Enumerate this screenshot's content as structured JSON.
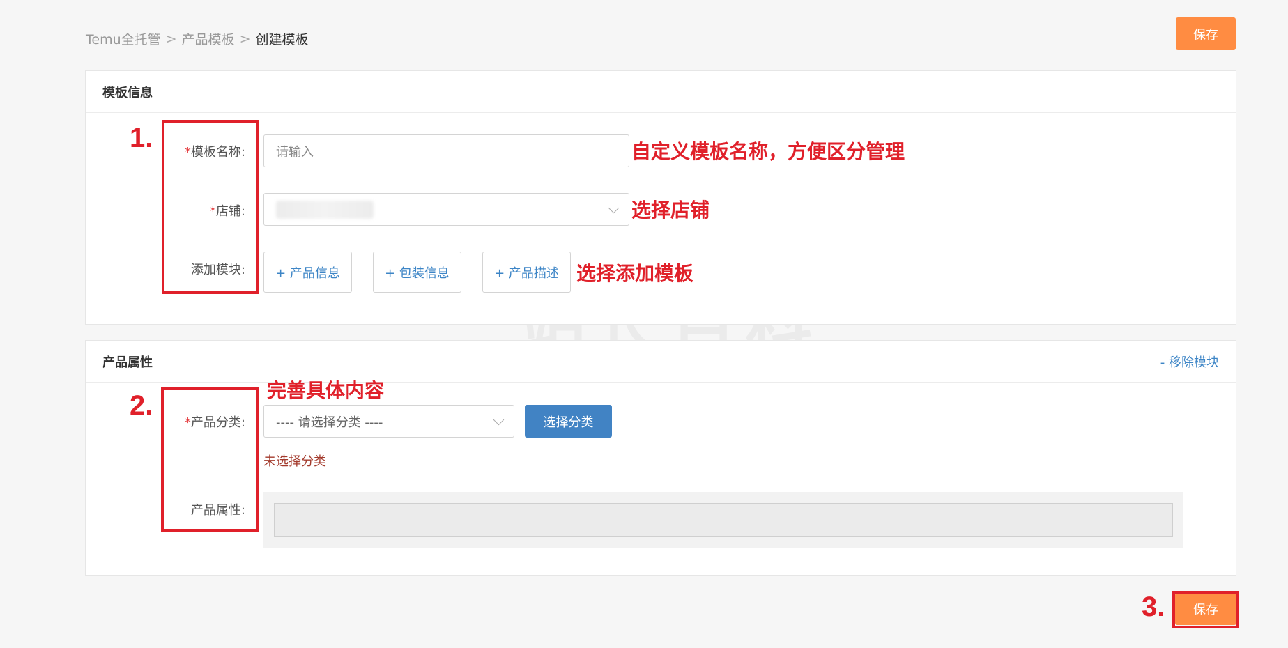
{
  "breadcrumb": {
    "items": [
      "Temu全托管",
      "产品模板",
      "创建模板"
    ]
  },
  "header": {
    "save_label": "保存"
  },
  "template_info": {
    "title": "模板信息",
    "name_label": "模板名称:",
    "name_placeholder": "请输入",
    "shop_label": "店铺:",
    "add_module_label": "添加模块:",
    "modules": [
      "+ 产品信息",
      "+ 包装信息",
      "+ 产品描述"
    ]
  },
  "product_attrs": {
    "title": "产品属性",
    "remove_label": "- 移除模块",
    "category_label": "产品分类:",
    "category_placeholder": "---- 请选择分类 ----",
    "choose_button": "选择分类",
    "error": "未选择分类",
    "attr_label": "产品属性:"
  },
  "annotations": {
    "n1": "1.",
    "n2": "2.",
    "n3": "3.",
    "name_note": "自定义模板名称，方便区分管理",
    "shop_note": "选择店铺",
    "module_note": "选择添加模板",
    "detail_note": "完善具体内容"
  },
  "footer": {
    "save_label": "保存"
  },
  "watermark": "站长百科",
  "colors": {
    "accent_orange": "#ff8c42",
    "link_blue": "#3d85c6",
    "button_blue": "#4183c4",
    "annotation_red": "#e0202a",
    "error_red": "#a33a2c"
  }
}
